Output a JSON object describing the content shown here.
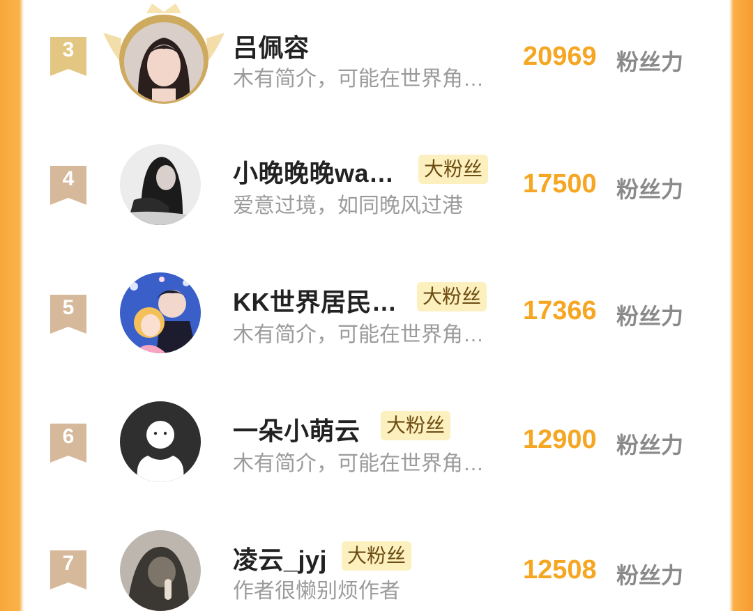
{
  "colors": {
    "accent": "#f5a623",
    "badge_gold": "#e2c682",
    "badge_bronze": "#d6b89a",
    "tag_bg": "#fdf0bf"
  },
  "ranking": {
    "unit_label": "粉丝力",
    "tag_label": "大粉丝",
    "items": [
      {
        "rank": "3",
        "name": "吕佩容",
        "bio": "木有简介，可能在世界角…",
        "score": "20969",
        "has_tag": false,
        "crown": true
      },
      {
        "rank": "4",
        "name": "小晚晚晚wa…",
        "bio": "爱意过境，如同晚风过港",
        "score": "17500",
        "has_tag": true
      },
      {
        "rank": "5",
        "name": "KK世界居民…",
        "bio": "木有简介，可能在世界角…",
        "score": "17366",
        "has_tag": true
      },
      {
        "rank": "6",
        "name": "一朵小萌云",
        "bio": "木有简介，可能在世界角…",
        "score": "12900",
        "has_tag": true
      },
      {
        "rank": "7",
        "name": "凌云_jyj",
        "bio": "作者很懒别烦作者",
        "score": "12508",
        "has_tag": true
      }
    ]
  }
}
